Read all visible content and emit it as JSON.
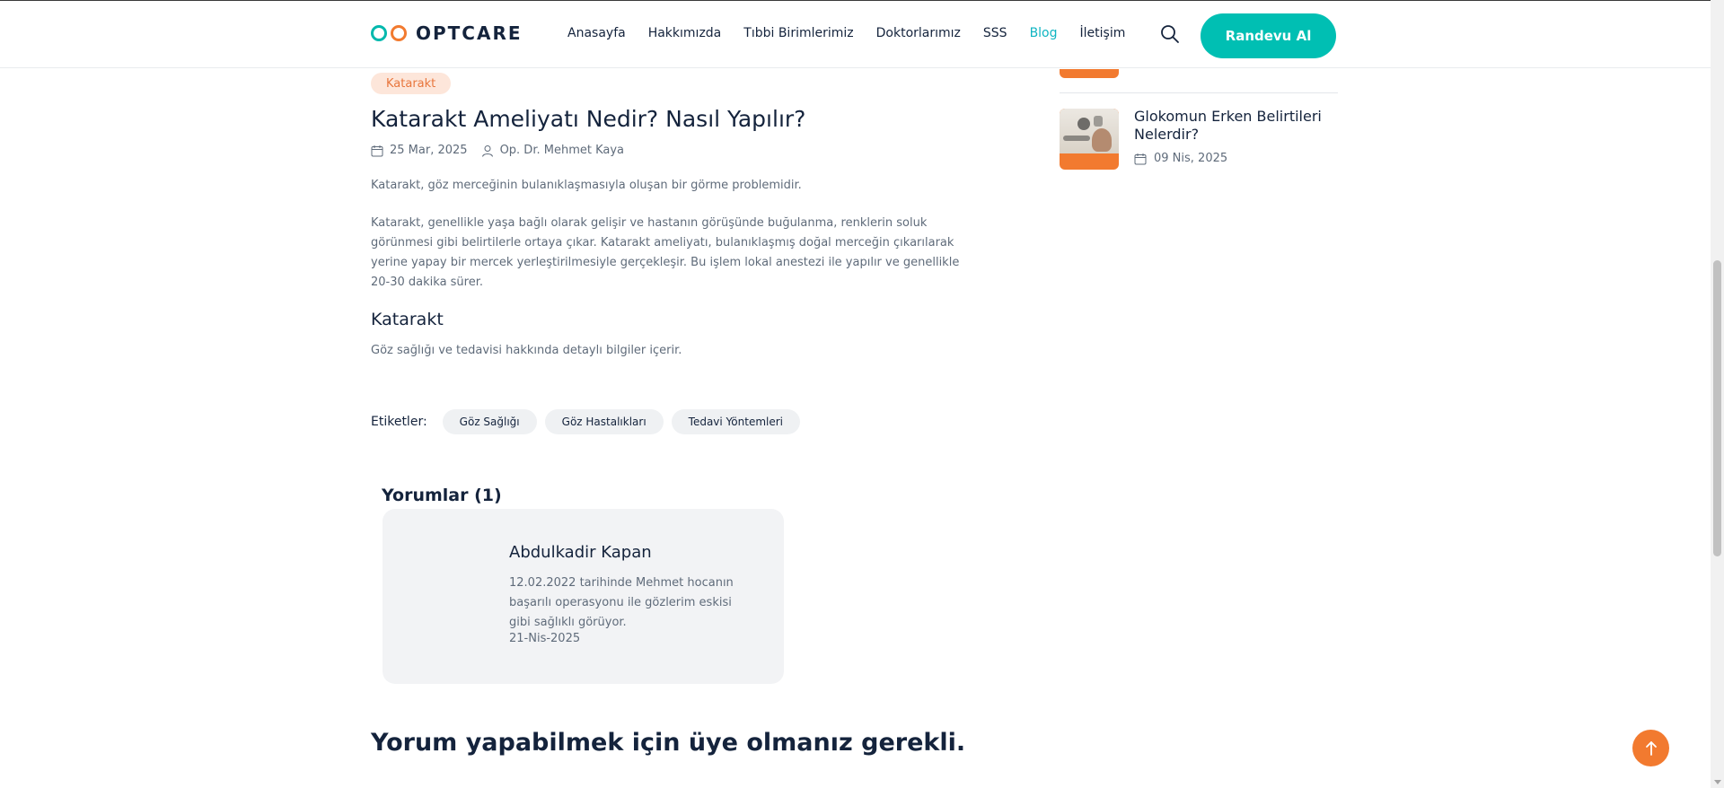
{
  "header": {
    "logo_text": "OPTCARE",
    "nav": [
      {
        "label": "Anasayfa",
        "active": false
      },
      {
        "label": "Hakkımızda",
        "active": false
      },
      {
        "label": "Tıbbi Birimlerimiz",
        "active": false
      },
      {
        "label": "Doktorlarımız",
        "active": false
      },
      {
        "label": "SSS",
        "active": false
      },
      {
        "label": "Blog",
        "active": true
      },
      {
        "label": "İletişim",
        "active": false
      }
    ],
    "search_icon": "search-icon",
    "cta_label": "Randevu Al"
  },
  "article": {
    "category": "Katarakt",
    "title": "Katarakt Ameliyatı Nedir? Nasıl Yapılır?",
    "date": "25 Mar, 2025",
    "author": "Op. Dr. Mehmet Kaya",
    "intro": "Katarakt, göz merceğinin bulanıklaşmasıyla oluşan bir görme problemidir.",
    "body": "Katarakt, genellikle yaşa bağlı olarak gelişir ve hastanın görüşünde buğulanma, renklerin soluk görünmesi gibi belirtilerle ortaya çıkar. Katarakt ameliyatı, bulanıklaşmış doğal merceğin çıkarılarak yerine yapay bir mercek yerleştirilmesiyle gerçekleşir. Bu işlem lokal anestezi ile yapılır ve genellikle 20-30 dakika sürer.",
    "subheading": "Katarakt",
    "subtext": "Göz sağlığı ve tedavisi hakkında detaylı bilgiler içerir."
  },
  "tags": {
    "label": "Etiketler:",
    "items": [
      "Göz Sağlığı",
      "Göz Hastalıkları",
      "Tedavi Yöntemleri"
    ]
  },
  "comments": {
    "title": "Yorumlar (1)",
    "items": [
      {
        "name": "Abdulkadir Kapan",
        "text": "12.02.2022 tarihinde Mehmet hocanın başarılı operasyonu ile gözlerim eskisi gibi sağlıklı görüyor.",
        "date": "21-Nis-2025"
      }
    ],
    "login_note": "Yorum yapabilmek için üye olmanız gerekli."
  },
  "sidebar": {
    "recent_posts": [
      {
        "title": "Glokomun Erken Belirtileri Nelerdir?",
        "date": "09 Nis, 2025"
      }
    ]
  },
  "colors": {
    "primary": "#00bfb3",
    "accent_orange": "#f27a2f",
    "nav_active": "#10b5c2",
    "text_dark": "#14233c",
    "text_muted": "#5f6b7a"
  }
}
